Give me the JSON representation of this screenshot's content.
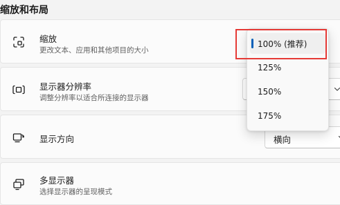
{
  "section_title": "缩放和布局",
  "rows": [
    {
      "title": "缩放",
      "subtitle": "更改文本、应用和其他项目的大小",
      "icon": "scale-icon"
    },
    {
      "title": "显示器分辨率",
      "subtitle": "调整分辨率以适合所连接的显示器",
      "icon": "resolution-icon"
    },
    {
      "title": "显示方向",
      "icon": "orientation-icon"
    },
    {
      "title": "多显示器",
      "subtitle": "选择显示器的呈现模式",
      "icon": "multi-display-icon"
    }
  ],
  "orientation_value": "横向",
  "scale_options": [
    "100% (推荐)",
    "125%",
    "150%",
    "175%"
  ],
  "selected_scale": "100% (推荐)",
  "colors": {
    "accent": "#005fb8",
    "highlight_box": "#e53935",
    "background": "#f3f3f3",
    "card": "#fbfbfb"
  }
}
